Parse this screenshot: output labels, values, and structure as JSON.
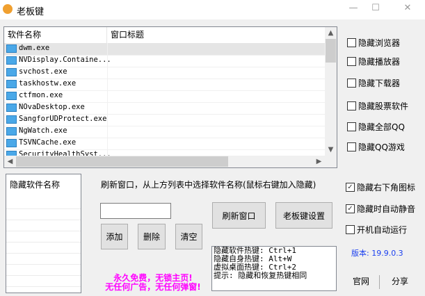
{
  "window": {
    "title": "老板键",
    "minimize": "—",
    "maximize": "☐",
    "close": "✕"
  },
  "process_list": {
    "columns": [
      "软件名称",
      "窗口标题"
    ],
    "rows": [
      {
        "name": "dwm.exe",
        "selected": true
      },
      {
        "name": "NVDisplay.Containe..."
      },
      {
        "name": "svchost.exe"
      },
      {
        "name": "taskhostw.exe"
      },
      {
        "name": "ctfmon.exe"
      },
      {
        "name": "NOvaDesktop.exe"
      },
      {
        "name": "SangforUDProtect.exe"
      },
      {
        "name": "NgWatch.exe"
      },
      {
        "name": "TSVNCache.exe"
      },
      {
        "name": "SecurityHealthSyst..."
      }
    ]
  },
  "hide_options": [
    {
      "label": "隐藏浏览器",
      "checked": false
    },
    {
      "label": "隐藏播放器",
      "checked": false
    },
    {
      "label": "隐藏下载器",
      "checked": false
    },
    {
      "label": "隐藏股票软件",
      "checked": false
    },
    {
      "label": "隐藏全部QQ",
      "checked": false
    },
    {
      "label": "隐藏QQ游戏",
      "checked": false
    }
  ],
  "hidden_list": {
    "header": "隐藏软件名称"
  },
  "instruction": "刷新窗口，从上方列表中选择软件名称(鼠标右键加入隐藏)",
  "input": {
    "value": ""
  },
  "buttons": {
    "add": "添加",
    "delete": "删除",
    "clear": "清空",
    "refresh": "刷新窗口",
    "settings": "老板键设置",
    "website": "官网",
    "share": "分享"
  },
  "hotkeys": [
    "隐藏软件热键: Ctrl+1",
    "隐藏自身热键: Alt+W",
    "虚拟桌面热键: Ctrl+2",
    "提示: 隐藏和恢复热键相同"
  ],
  "promo": [
    "永久免费，无锁主页!",
    "无任何广告，无任何弹窗!"
  ],
  "settings": [
    {
      "label": "隐藏右下角图标",
      "checked": true
    },
    {
      "label": "隐藏时自动静音",
      "checked": true
    },
    {
      "label": "开机自动运行",
      "checked": false
    }
  ],
  "version": "版本: 19.9.0.3"
}
